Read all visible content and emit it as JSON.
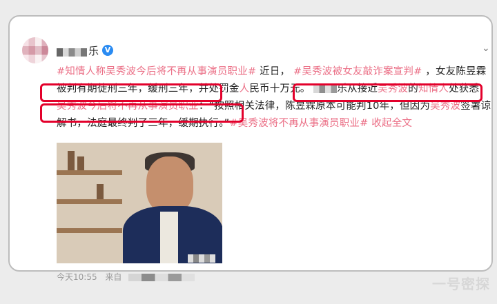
{
  "post": {
    "username_suffix": "乐",
    "part1_hashtag": "#知情人称吴秀波今后将不再从事演员职业#",
    "part2": " 近日，",
    "part3_hashtag": "#吴秀波被女友敲诈案宣判#",
    "part4": "，女友陈昱霖被判有期徒刑三年，缓刑三年，并处罚金",
    "part5_hl": "人",
    "part6": "民币十万元。",
    "part7": "乐从接近",
    "part8_hl": "吴秀波",
    "part9": "的",
    "part10_hl": "知情人",
    "part11": "处获悉，",
    "part12_hl": "吴秀波今后将不再从事演员职业",
    "part13": "：“按照相关法律，陈昱霖原本可能判10年，但因为",
    "part14_hl": "吴秀波",
    "part15": "签署谅解书，法庭最终判了三年，缓期执行。”",
    "part16_hashtag": "#吴秀波将不再从事演员职业#",
    "part17": " 收起全文",
    "collapse_icon": "^"
  },
  "meta": {
    "time": "今天10:55",
    "source": "来自"
  },
  "watermark": "一号密探",
  "icons": {
    "verified": "V",
    "chevron": "⌄"
  }
}
